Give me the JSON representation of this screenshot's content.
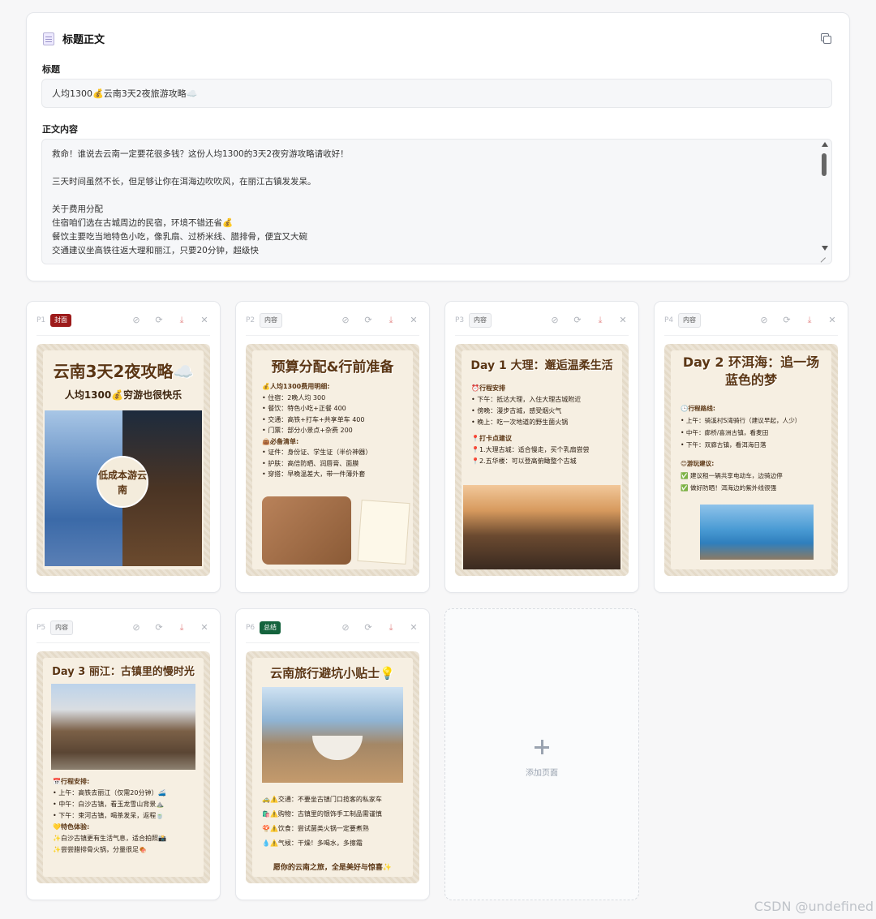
{
  "editor": {
    "header": "标题正文",
    "title_label": "标题",
    "title_value": "人均1300💰云南3天2夜旅游攻略☁️",
    "body_label": "正文内容",
    "body_lines": [
      "救命！谁说去云南一定要花很多钱？这份人均1300的3天2夜穷游攻略请收好！",
      "",
      "三天时间虽然不长，但足够让你在洱海边吹吹风，在丽江古镇发发呆。",
      "",
      "关于费用分配",
      "住宿咱们选在古城周边的民宿，环境不错还省💰",
      "餐饮主要吃当地特色小吃，像乳扇、过桥米线、腊排骨，便宜又大碗",
      "交通建议坐高铁往返大理和丽江，只要20分钟，超级快"
    ]
  },
  "pages": [
    {
      "num": "P1",
      "tag": "封面",
      "title": "云南3天2夜攻略☁️",
      "subtitle": "人均1300💰穷游也很快乐",
      "badge": "低成本游云南"
    },
    {
      "num": "P2",
      "tag": "内容",
      "title": "预算分配&行前准备",
      "lines": [
        "💰人均1300费用明细:",
        "• 住宿：2晚人均 300",
        "• 餐饮：特色小吃+正餐 400",
        "• 交通：高铁+打车+共享单车 400",
        "• 门票：部分小景点+杂费 200",
        "👜必备清单:",
        "• 证件：身份证、学生证（半价神器）",
        "• 护肤：高倍防晒、润唇膏、面膜",
        "• 穿搭：早晚温差大，带一件薄外套"
      ]
    },
    {
      "num": "P3",
      "tag": "内容",
      "title": "Day 1 大理：邂逅温柔生活",
      "lines": [
        "⏰行程安排",
        "• 下午：抵达大理，入住大理古城附近",
        "• 傍晚：漫步古城，感受烟火气",
        "• 晚上：吃一次地道的野生菌火锅",
        "📍打卡点建议",
        "📍1.大理古城：适合慢走，买个乳扇尝尝",
        "📍2.五华楼：可以登高俯瞰整个古城"
      ]
    },
    {
      "num": "P4",
      "tag": "内容",
      "title": "Day 2 环洱海：追一场蓝色的梦",
      "lines": [
        "🕒行程路线:",
        "• 上午：骑溪村S湾骑行（建议早起，人少）",
        "• 中午：廊桥/喜洲古镇，看麦田",
        "• 下午：双廊古镇，看洱海日落",
        "",
        "😊游玩建议:",
        "✅ 建议租一辆共享电动车，边骑边停",
        "✅ 做好防晒！洱海边的紫外线很强"
      ]
    },
    {
      "num": "P5",
      "tag": "内容",
      "title": "Day 3 丽江：古镇里的慢时光",
      "lines": [
        "📅行程安排:",
        "• 上午：高铁去丽江（仅需20分钟）🚄",
        "• 中午：白沙古镇，看玉龙雪山背景⛰️",
        "• 下午：束河古镇，喝茶发呆，返程🍵",
        "💛特色体验:",
        "✨白沙古镇更有生活气息，适合拍照📸",
        "✨尝尝腊排骨火锅，分量很足🍖"
      ]
    },
    {
      "num": "P6",
      "tag": "总结",
      "title": "云南旅行避坑小贴士💡",
      "lines": [
        "🚕⚠️交通：不要坐古镇门口揽客的私家车",
        "🛍️⚠️购物：古镇里的银饰手工制品需谨慎",
        "🍄⚠️饮食：尝试菌类火锅一定要煮熟",
        "💧⚠️气候：干燥！多喝水，多擦霜"
      ],
      "footer": "愿你的云南之旅，全是美好与惊喜✨"
    }
  ],
  "add_page_label": "添加页面",
  "watermark": "CSDN @undefined",
  "colors": {
    "cover_tag": "#9d1b1b",
    "summary_tag": "#14633d",
    "accent_brown": "#5b3614"
  },
  "icons": [
    "document-icon",
    "copy-icon",
    "hide-icon",
    "refresh-icon",
    "download-icon",
    "close-icon",
    "plus-icon"
  ]
}
